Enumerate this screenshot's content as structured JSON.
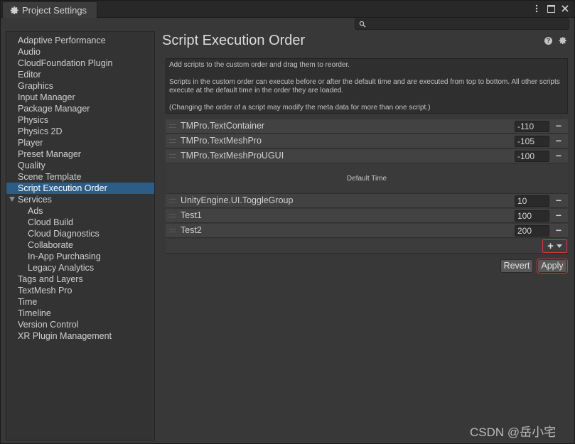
{
  "window": {
    "tab_title": "Project Settings",
    "search_placeholder": ""
  },
  "sidebar": {
    "items": [
      {
        "label": "Adaptive Performance",
        "indent": 0
      },
      {
        "label": "Audio",
        "indent": 0
      },
      {
        "label": "CloudFoundation Plugin",
        "indent": 0
      },
      {
        "label": "Editor",
        "indent": 0
      },
      {
        "label": "Graphics",
        "indent": 0
      },
      {
        "label": "Input Manager",
        "indent": 0
      },
      {
        "label": "Package Manager",
        "indent": 0
      },
      {
        "label": "Physics",
        "indent": 0
      },
      {
        "label": "Physics 2D",
        "indent": 0
      },
      {
        "label": "Player",
        "indent": 0
      },
      {
        "label": "Preset Manager",
        "indent": 0
      },
      {
        "label": "Quality",
        "indent": 0
      },
      {
        "label": "Scene Template",
        "indent": 0
      },
      {
        "label": "Script Execution Order",
        "indent": 0,
        "selected": true
      },
      {
        "label": "Services",
        "indent": 0,
        "expanded": true
      },
      {
        "label": "Ads",
        "indent": 1
      },
      {
        "label": "Cloud Build",
        "indent": 1
      },
      {
        "label": "Cloud Diagnostics",
        "indent": 1
      },
      {
        "label": "Collaborate",
        "indent": 1
      },
      {
        "label": "In-App Purchasing",
        "indent": 1
      },
      {
        "label": "Legacy Analytics",
        "indent": 1
      },
      {
        "label": "Tags and Layers",
        "indent": 0
      },
      {
        "label": "TextMesh Pro",
        "indent": 0
      },
      {
        "label": "Time",
        "indent": 0
      },
      {
        "label": "Timeline",
        "indent": 0
      },
      {
        "label": "Version Control",
        "indent": 0
      },
      {
        "label": "XR Plugin Management",
        "indent": 0
      }
    ]
  },
  "main": {
    "title": "Script Execution Order",
    "help": {
      "line1": "Add scripts to the custom order and drag them to reorder.",
      "line2": "Scripts in the custom order can execute before or after the default time and are executed from top to bottom. All other scripts execute at the default time in the order they are loaded.",
      "line3": "(Changing the order of a script may modify the meta data for more than one script.)"
    },
    "before_default": [
      {
        "name": "TMPro.TextContainer",
        "order": "-110"
      },
      {
        "name": "TMPro.TextMeshPro",
        "order": "-105"
      },
      {
        "name": "TMPro.TextMeshProUGUI",
        "order": "-100"
      }
    ],
    "default_time_label": "Default Time",
    "after_default": [
      {
        "name": "UnityEngine.UI.ToggleGroup",
        "order": "10"
      },
      {
        "name": "Test1",
        "order": "100"
      },
      {
        "name": "Test2",
        "order": "200"
      }
    ],
    "add_label": "+",
    "remove_label": "−",
    "revert_label": "Revert",
    "apply_label": "Apply"
  },
  "watermark": "CSDN @岳小宅",
  "colors": {
    "selection": "#2c5d87",
    "highlight_border": "#d23a3a"
  }
}
